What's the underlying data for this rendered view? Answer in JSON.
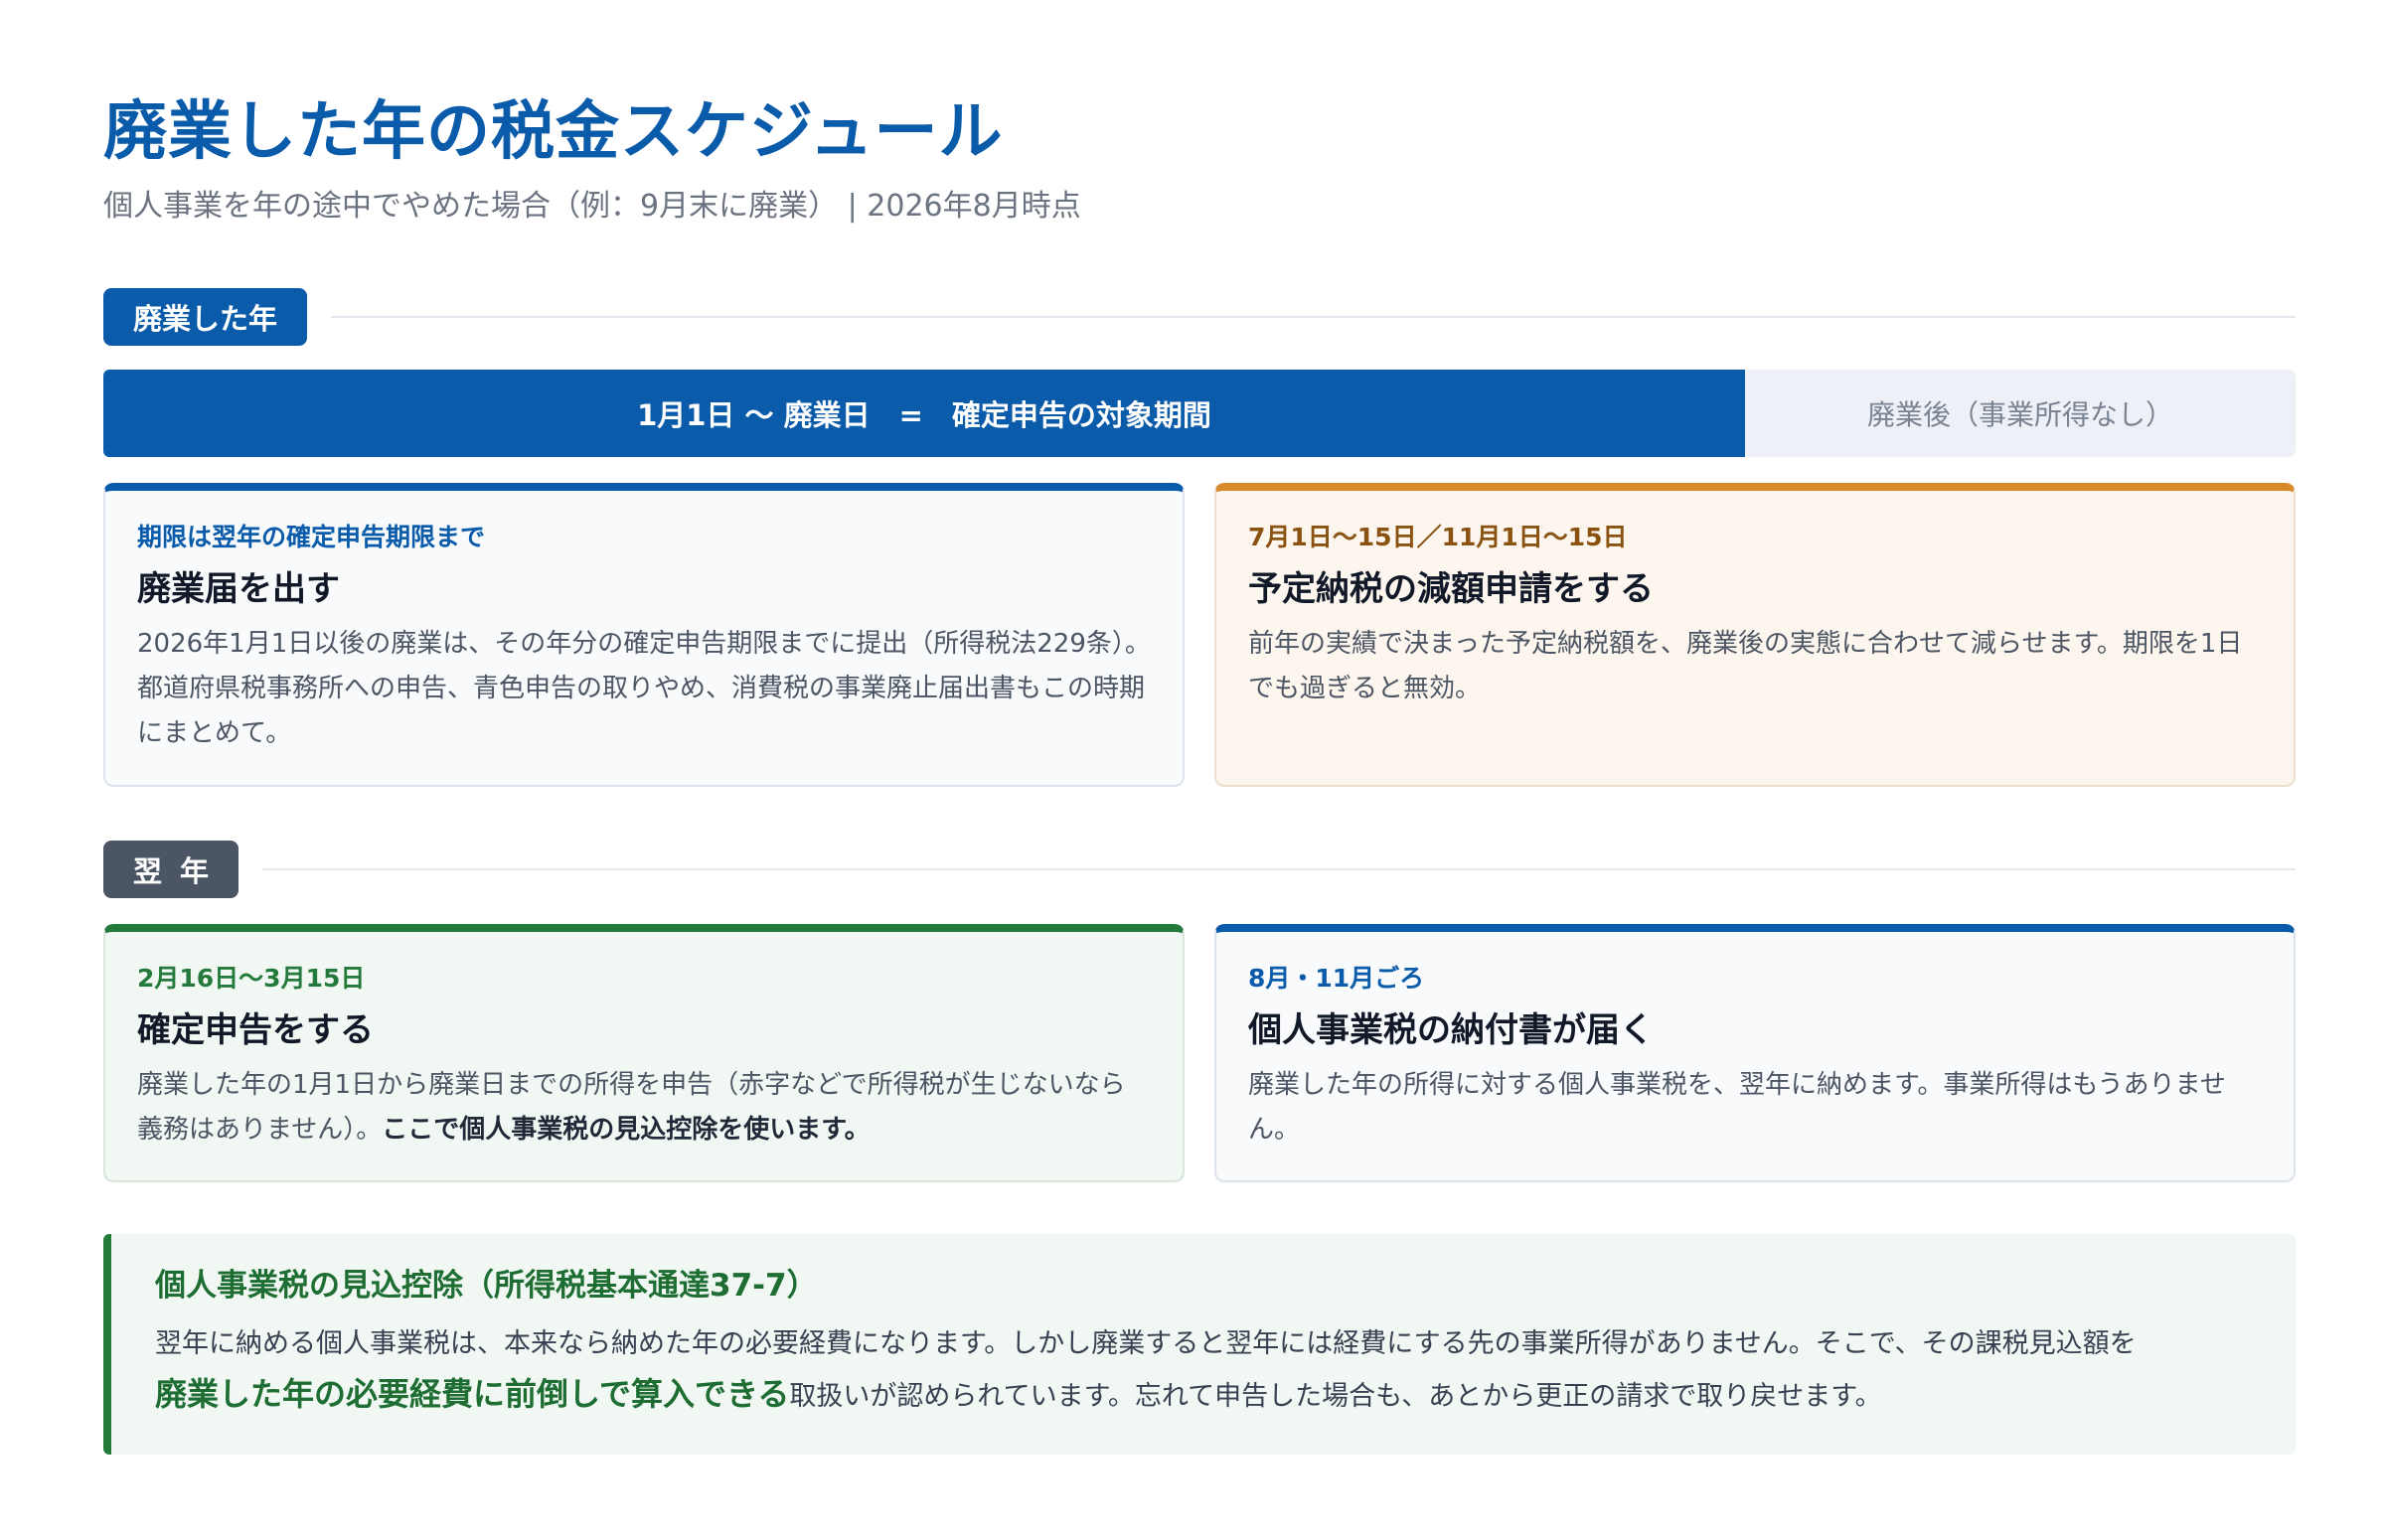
{
  "header": {
    "title": "廃業した年の税金スケジュール",
    "subtitle": "個人事業を年の途中でやめた場合（例：9月末に廃業） | 2026年8月時点"
  },
  "sections": {
    "first": {
      "tag": "廃業した年",
      "timeline": {
        "active_label": "1月1日 〜 廃業日　=　確定申告の対象期間",
        "rest_label": "廃業後（事業所得なし）"
      },
      "cards": [
        {
          "kicker": "期限は翌年の確定申告期限まで",
          "title": "廃業届を出す",
          "body": "2026年1月1日以後の廃業は、その年分の確定申告期限までに提出（所得税法229条）。都道府県税事務所への申告、青色申告の取りやめ、消費税の事業廃止届出書もこの時期にまとめて。"
        },
        {
          "kicker": "7月1日〜15日／11月1日〜15日",
          "title": "予定納税の減額申請をする",
          "body": "前年の実績で決まった予定納税額を、廃業後の実態に合わせて減らせます。期限を1日でも過ぎると無効。"
        }
      ]
    },
    "second": {
      "tag": "翌年",
      "cards": [
        {
          "kicker": "2月16日〜3月15日",
          "title": "確定申告をする",
          "body": "廃業した年の1月1日から廃業日までの所得を申告（赤字などで所得税が生じないなら義務はありません）。",
          "body_emphasis": "ここで個人事業税の見込控除を使います。"
        },
        {
          "kicker": "8月・11月ごろ",
          "title": "個人事業税の納付書が届く",
          "body": "廃業した年の所得に対する個人事業税を、翌年に納めます。事業所得はもうありません。"
        }
      ]
    }
  },
  "note": {
    "title": "個人事業税の見込控除（所得税基本通達37-7）",
    "body_before": "翌年に納める個人事業税は、本来なら納めた年の必要経費になります。しかし廃業すると翌年には経費にする先の事業所得がありません。そこで、その課税見込額を",
    "body_emphasis": "廃業した年の必要経費に前倒しで算入できる",
    "body_after": "取扱いが認められています。忘れて申告した場合も、あとから更正の請求で取り戻せます。"
  }
}
